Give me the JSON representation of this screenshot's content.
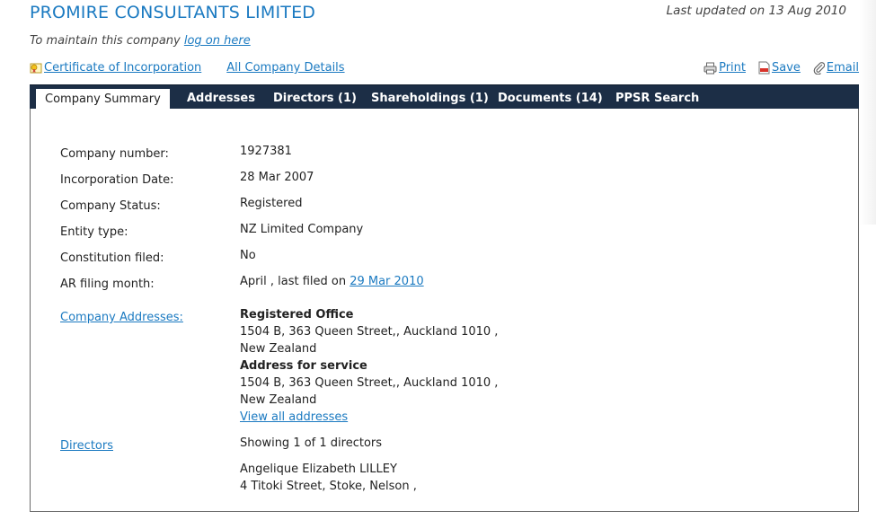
{
  "header": {
    "company_name": "PROMIRE CONSULTANTS LIMITED",
    "last_updated": "Last updated on 13 Aug 2010",
    "maintain_text": "To maintain this company ",
    "logon_link": "log on here"
  },
  "links": {
    "certificate": "Certificate of Incorporation",
    "all_details": "All Company Details"
  },
  "tools": {
    "print": "Print",
    "save": "Save",
    "email": "Email"
  },
  "tabs": {
    "summary": "Company Summary",
    "addresses": "Addresses",
    "directors": "Directors (1)",
    "shareholdings": "Shareholdings (1)",
    "documents": "Documents (14)",
    "ppsr": "PPSR Search"
  },
  "summary": {
    "company_number_label": "Company number:",
    "company_number": "1927381",
    "incorporation_label": "Incorporation Date:",
    "incorporation_date": "28 Mar 2007",
    "status_label": "Company Status:",
    "status": "Registered",
    "entity_label": "Entity type:",
    "entity": "NZ Limited Company",
    "constitution_label": "Constitution filed:",
    "constitution": "No",
    "ar_label": "AR filing month:",
    "ar_month": "April , last filed on ",
    "ar_last_filed": "29 Mar 2010"
  },
  "addresses": {
    "section_link": "Company Addresses:",
    "registered_heading": "Registered Office",
    "registered_line1": "1504 B, 363 Queen Street,, Auckland 1010 ,",
    "registered_line2": "New Zealand",
    "service_heading": "Address for service",
    "service_line1": "1504 B, 363 Queen Street,, Auckland 1010 ,",
    "service_line2": "New Zealand",
    "view_all": "View all addresses"
  },
  "directors": {
    "section_link": "Directors",
    "showing": "Showing 1 of 1 directors",
    "name": "Angelique Elizabeth LILLEY",
    "address": "4 Titoki Street, Stoke, Nelson ,"
  },
  "colors": {
    "link": "#1b7ac1",
    "tabbar": "#1c2e46"
  }
}
